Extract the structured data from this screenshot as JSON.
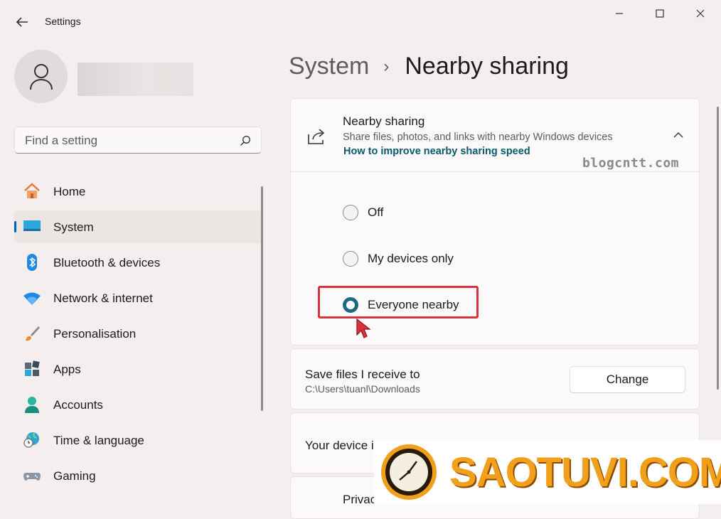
{
  "window": {
    "title": "Settings",
    "controls": [
      "minimize",
      "maximize",
      "close"
    ]
  },
  "search": {
    "placeholder": "Find a setting"
  },
  "sidebar": {
    "items": [
      {
        "label": "Home",
        "icon": "home-icon"
      },
      {
        "label": "System",
        "icon": "system-icon",
        "active": true
      },
      {
        "label": "Bluetooth & devices",
        "icon": "bluetooth-icon"
      },
      {
        "label": "Network & internet",
        "icon": "wifi-icon"
      },
      {
        "label": "Personalisation",
        "icon": "brush-icon"
      },
      {
        "label": "Apps",
        "icon": "apps-icon"
      },
      {
        "label": "Accounts",
        "icon": "accounts-icon"
      },
      {
        "label": "Time & language",
        "icon": "time-language-icon"
      },
      {
        "label": "Gaming",
        "icon": "gaming-icon"
      }
    ]
  },
  "breadcrumb": {
    "parent": "System",
    "separator": "›",
    "current": "Nearby sharing"
  },
  "nearby": {
    "title": "Nearby sharing",
    "description": "Share files, photos, and links with nearby Windows devices",
    "link": "How to improve nearby sharing speed",
    "options": [
      {
        "label": "Off",
        "checked": false
      },
      {
        "label": "My devices only",
        "checked": false
      },
      {
        "label": "Everyone nearby",
        "checked": true
      }
    ]
  },
  "save": {
    "title": "Save files I receive to",
    "path": "C:\\Users\\tuanl\\Downloads",
    "button": "Change"
  },
  "device": {
    "text": "Your device i"
  },
  "privacy": {
    "text": "Privac"
  },
  "watermarks": {
    "blog": "blogcntt.com",
    "brand": "SAOTUVI.COM"
  },
  "colors": {
    "accent": "#005fb8",
    "selected_radio": "#1e6a80",
    "highlight": "#d9323a",
    "brand": "#f2a01c"
  }
}
